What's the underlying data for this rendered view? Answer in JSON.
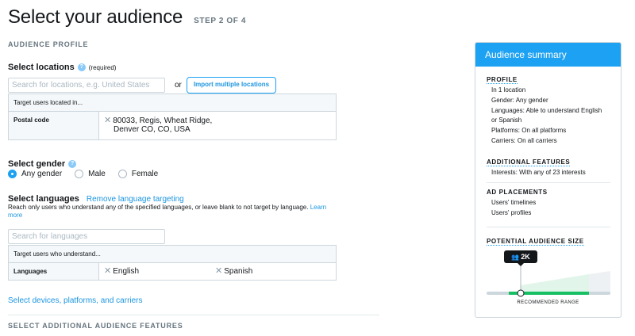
{
  "header": {
    "title": "Select your audience",
    "step": "STEP 2 OF 4"
  },
  "audience_profile": {
    "section_label": "AUDIENCE PROFILE",
    "locations": {
      "label": "Select locations",
      "required": "(required)",
      "search_placeholder": "Search for locations, e.g. United States",
      "or": "or",
      "import_button": "Import multiple locations",
      "table_header": "Target users located in...",
      "row_label": "Postal code",
      "value_line1": "80033, Regis, Wheat Ridge,",
      "value_line2": "Denver CO, CO, USA"
    },
    "gender": {
      "label": "Select gender",
      "options": [
        "Any gender",
        "Male",
        "Female"
      ],
      "selected": "Any gender"
    },
    "languages": {
      "label": "Select languages",
      "remove_link": "Remove language targeting",
      "description": "Reach only users who understand any of the specified languages, or leave blank to not target by language.",
      "learn_more": "Learn more",
      "search_placeholder": "Search for languages",
      "table_header": "Target users who understand...",
      "row_label": "Languages",
      "values": [
        "English",
        "Spanish"
      ]
    },
    "devices_link": "Select devices, platforms, and carriers",
    "additional_label": "SELECT ADDITIONAL AUDIENCE FEATURES"
  },
  "summary": {
    "title": "Audience summary",
    "profile_heading": "PROFILE",
    "profile_lines": [
      "In 1 location",
      "Gender: Any gender",
      "Languages: Able to understand English",
      "or Spanish",
      "Platforms: On all platforms",
      "Carriers: On all carriers"
    ],
    "additional_heading": "ADDITIONAL FEATURES",
    "additional_lines": [
      "Interests: With any of 23 interests"
    ],
    "placements_heading": "AD PLACEMENTS",
    "placements_lines": [
      "Users' timelines",
      "Users' profiles"
    ],
    "size_heading": "POTENTIAL AUDIENCE SIZE",
    "size_value": "2K",
    "range_caption": "RECOMMENDED RANGE"
  },
  "colors": {
    "accent": "#1da1f2",
    "link": "#1b95e0",
    "meter_green": "#17bf63",
    "meter_light": "#d3efe0"
  }
}
